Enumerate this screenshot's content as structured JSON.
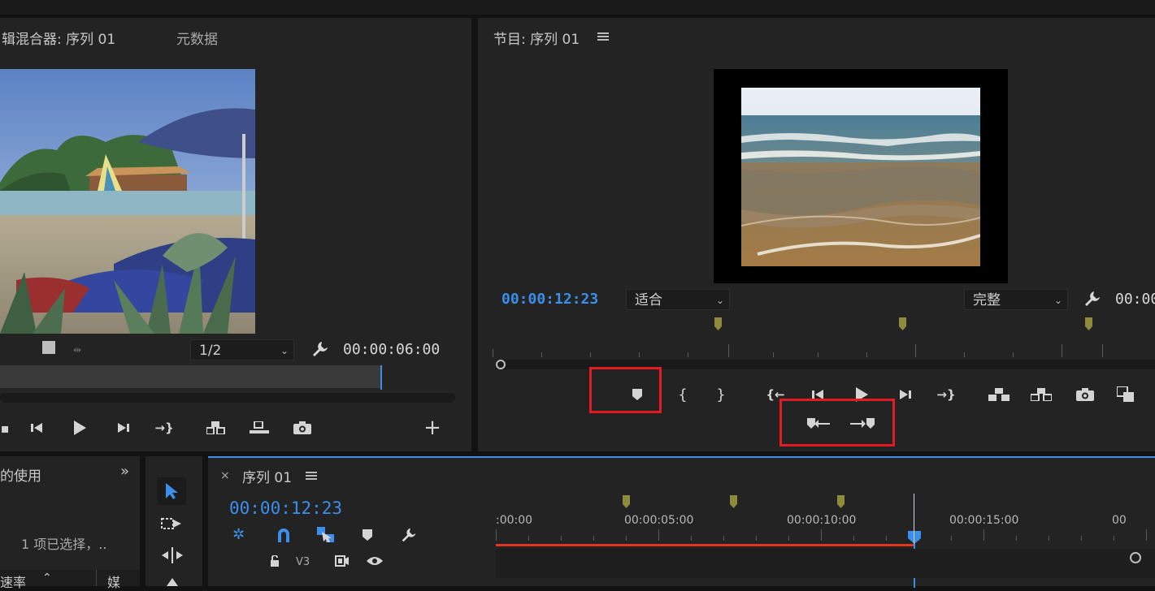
{
  "source_panel": {
    "tab_mixer": "辑混合器: 序列 01",
    "tab_metadata": "元数据",
    "resolution": "1/2",
    "timecode": "00:00:06:00"
  },
  "program_panel": {
    "title": "节目: 序列 01",
    "timecode": "00:00:12:23",
    "fit": "适合",
    "quality": "完整",
    "timecode_right": "00:00"
  },
  "project_panel": {
    "tab_label": "的使用",
    "selection_text": "1 项已选择，..",
    "col1": "速率",
    "col2": "媒"
  },
  "timeline": {
    "title": "序列 01",
    "timecode": "00:00:12:23",
    "ruler_labels": [
      ":00:00",
      "00:00:05:00",
      "00:00:10:00",
      "00:00:15:00",
      "00"
    ],
    "track_name": "V3"
  },
  "colors": {
    "accent_blue": "#3b8eea",
    "highlight_red": "#e51b23",
    "marker_olive": "#8f8a3c",
    "work_area_red": "#e5331f"
  },
  "icons": {
    "add_marker": "marker-icon",
    "mark_in": "mark-in-icon",
    "mark_out": "mark-out-icon",
    "go_to_in": "go-to-in-icon",
    "step_back": "step-back-icon",
    "play": "play-icon",
    "step_forward": "step-forward-icon",
    "go_to_out": "go-to-out-icon",
    "lift": "lift-icon",
    "extract": "extract-icon",
    "export_frame": "camera-icon",
    "compare": "compare-icon",
    "prev_marker": "go-to-previous-marker-icon",
    "next_marker": "go-to-next-marker-icon"
  }
}
